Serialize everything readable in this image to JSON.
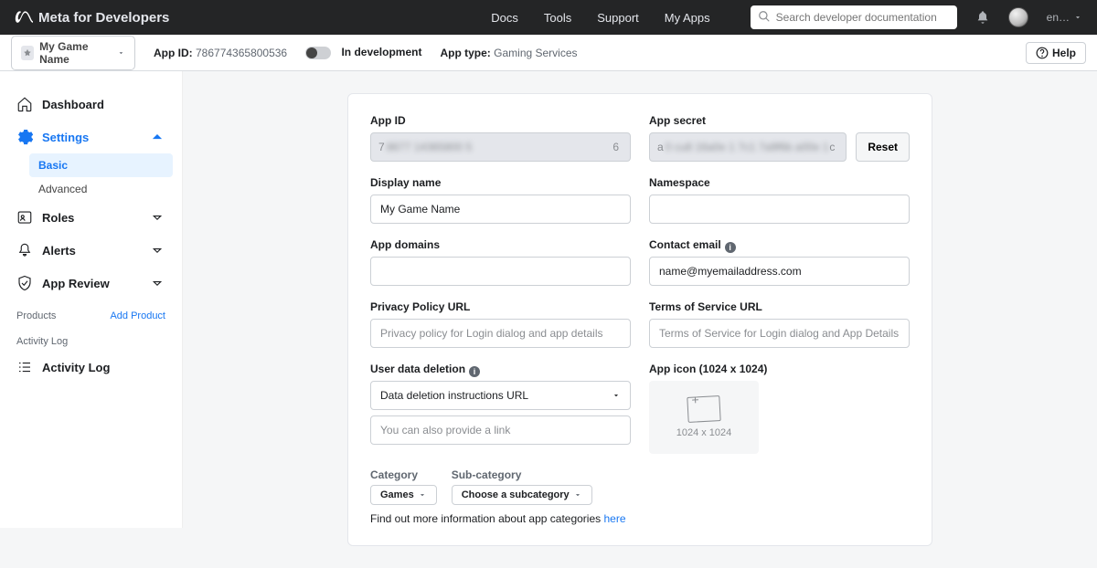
{
  "topbar": {
    "brand": "Meta for Developers",
    "nav": {
      "docs": "Docs",
      "tools": "Tools",
      "support": "Support",
      "myapps": "My Apps"
    },
    "search_placeholder": "Search developer documentation",
    "lang": "en…"
  },
  "appbar": {
    "app_name": "My Game Name",
    "app_id_label": "App ID:",
    "app_id": "786774365800536",
    "status": "In development",
    "app_type_label": "App type:",
    "app_type": "Gaming Services",
    "help": "Help"
  },
  "sidebar": {
    "dashboard": "Dashboard",
    "settings": "Settings",
    "basic": "Basic",
    "advanced": "Advanced",
    "roles": "Roles",
    "alerts": "Alerts",
    "app_review": "App Review",
    "products_heading": "Products",
    "add_product": "Add Product",
    "activity_heading": "Activity Log",
    "activity_log": "Activity Log"
  },
  "form": {
    "app_id_label": "App ID",
    "app_id_first": "7",
    "app_id_mask": "8677 14365800 5",
    "app_id_last": "6",
    "app_secret_label": "App secret",
    "app_secret_first": "a",
    "app_secret_mask": "0 cu8 16a0e 1 7c1 7a9f6b a00e 1",
    "app_secret_last": "c",
    "reset": "Reset",
    "display_name_label": "Display name",
    "display_name": "My Game Name",
    "namespace_label": "Namespace",
    "app_domains_label": "App domains",
    "contact_email_label": "Contact email",
    "contact_email": "name@myemailaddress.com",
    "privacy_label": "Privacy Policy URL",
    "privacy_ph": "Privacy policy for Login dialog and app details",
    "tos_label": "Terms of Service URL",
    "tos_ph": "Terms of Service for Login dialog and App Details",
    "user_del_label": "User data deletion",
    "user_del_select": "Data deletion instructions URL",
    "user_del_link_ph": "You can also provide a link",
    "app_icon_label": "App icon (1024 x 1024)",
    "app_icon_dim": "1024 x 1024",
    "category_label": "Category",
    "category_val": "Games",
    "subcat_label": "Sub-category",
    "subcat_val": "Choose a subcategory",
    "help_text": "Find out more information about app categories ",
    "help_link": "here"
  }
}
